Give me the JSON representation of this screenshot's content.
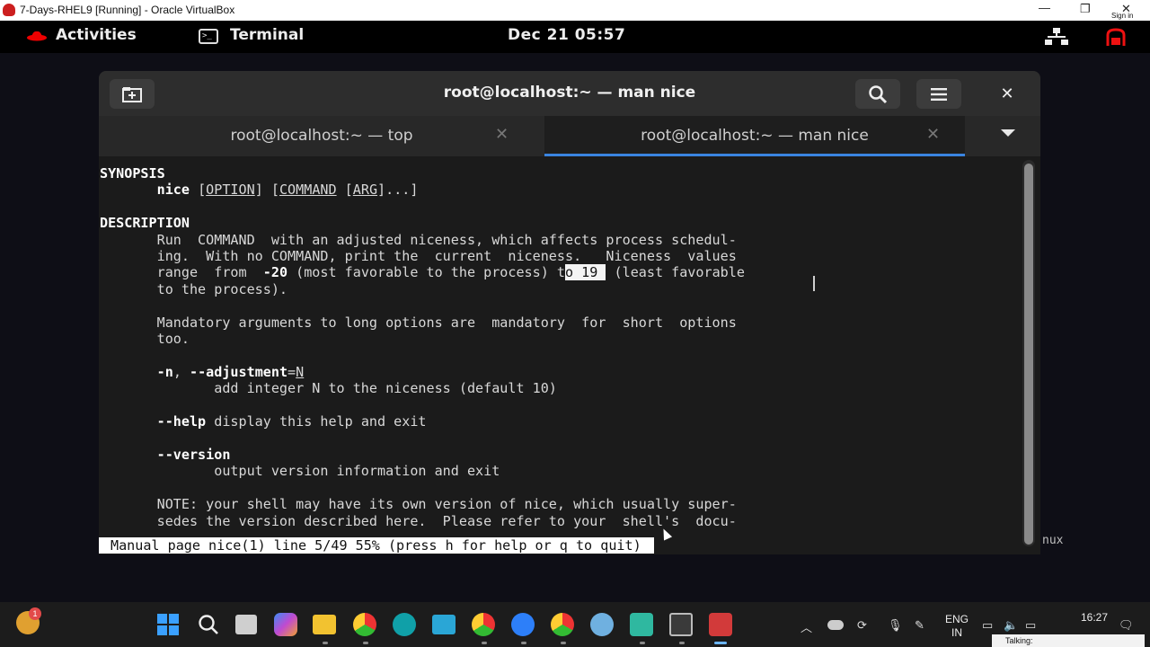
{
  "vbox": {
    "title": "7-Days-RHEL9 [Running] - Oracle VirtualBox",
    "minimize": "—",
    "maximize": "❐",
    "close": "✕",
    "signin": "Sign in"
  },
  "gnome": {
    "activities": "Activities",
    "app_name": "Terminal",
    "clock": "Dec 21  05:57"
  },
  "terminal": {
    "window_title": "root@localhost:~ — man nice",
    "tabs": [
      {
        "label": "root@localhost:~ — top",
        "close": "✕"
      },
      {
        "label": "root@localhost:~ — man nice",
        "close": "✕"
      }
    ],
    "window_close": "✕",
    "status_line": "Manual page nice(1) line 5/49 55% (press h for help or q to quit)"
  },
  "man": {
    "synopsis_heading": "SYNOPSIS",
    "synopsis_cmd": "nice",
    "synopsis_option": "OPTION",
    "synopsis_command": "COMMAND",
    "synopsis_arg": "ARG",
    "description_heading": "DESCRIPTION",
    "desc_l1": "Run  COMMAND  with an adjusted niceness, which affects process schedul-",
    "desc_l2": "ing.  With no COMMAND, print the  current  niceness.   Niceness  values",
    "desc_l3a": "range  from  ",
    "desc_l3_bold": "-20",
    "desc_l3b": " (most favorable to the process) t",
    "desc_l3_sel": "o 19 ",
    "desc_l3c": " (least favorable",
    "desc_l4": "to the process).",
    "mandatory_l1": "Mandatory arguments to long options are  mandatory  for  short  options",
    "mandatory_l2": "too.",
    "opt_n_short": "-n",
    "opt_n_long": "--adjustment",
    "opt_n_arg": "N",
    "opt_n_desc": "add integer N to the niceness (default 10)",
    "opt_help": "--help",
    "opt_help_desc": " display this help and exit",
    "opt_version": "--version",
    "opt_version_desc": "output version information and exit",
    "note_l1": "NOTE: your shell may have its own version of nice, which usually super-",
    "note_l2": "sedes the version described here.  Please refer to your  shell's  docu-"
  },
  "desktop": {
    "partial_text": "nux"
  },
  "taskbar": {
    "notification_count": "1",
    "lang_line1": "ENG",
    "lang_line2": "IN",
    "time": "16:27",
    "talking": "Talking:"
  }
}
